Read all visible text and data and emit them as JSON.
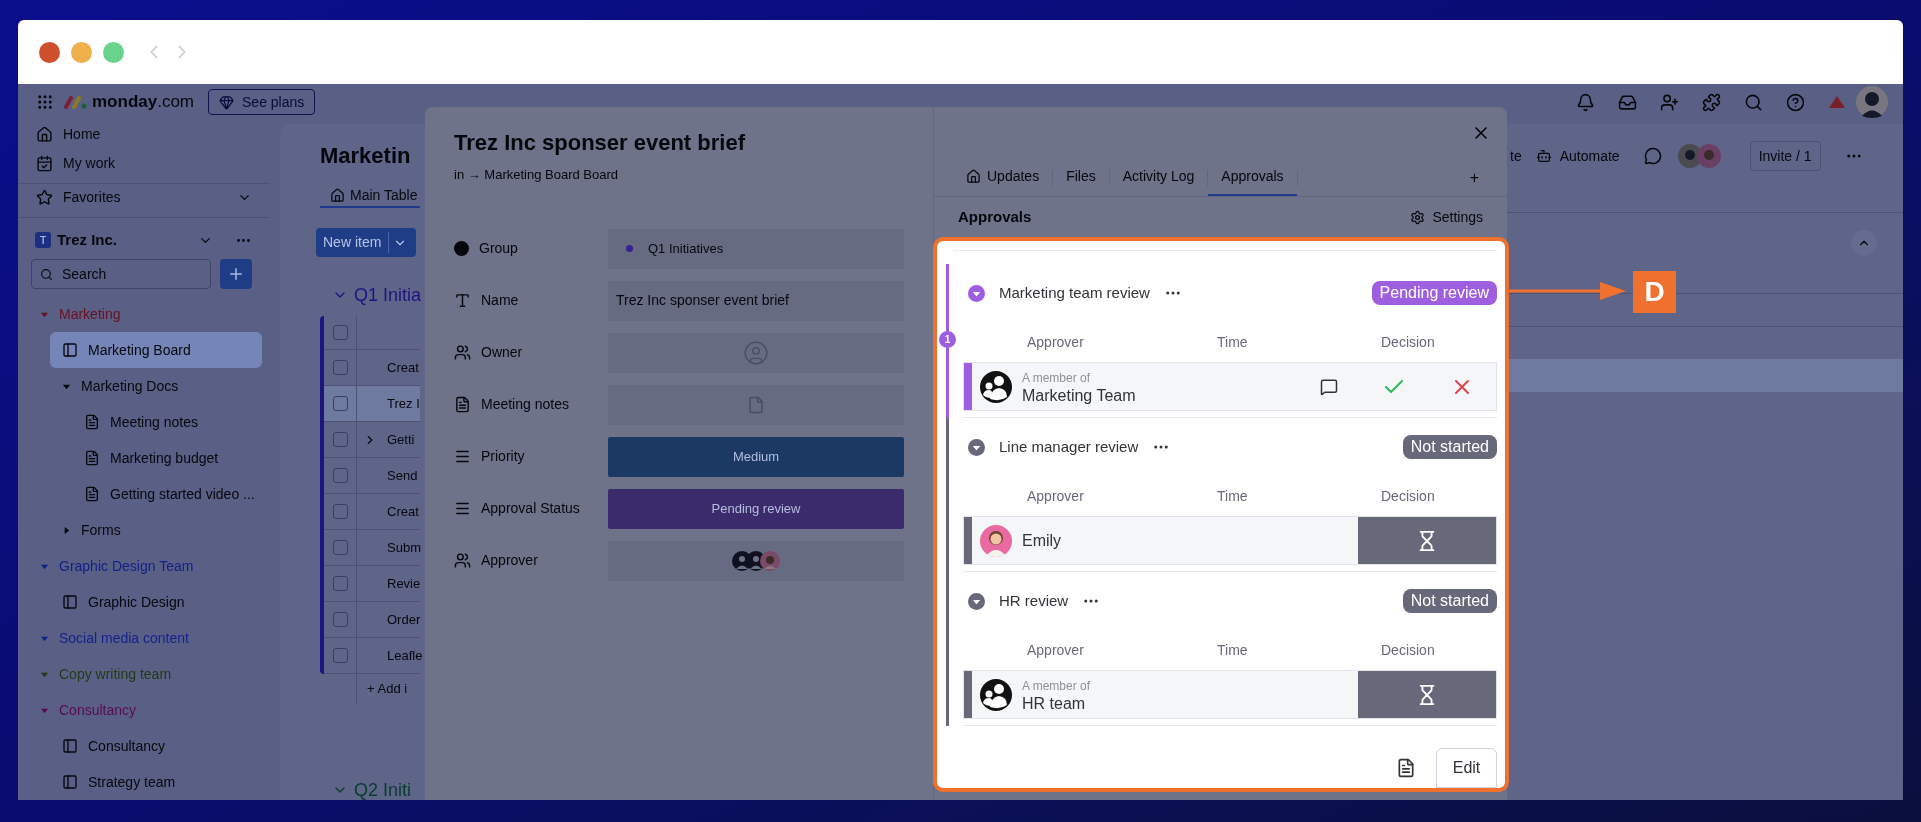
{
  "topbar": {
    "logo": {
      "name": "monday",
      "suffix": ".com"
    },
    "plans_button": "See plans"
  },
  "sidebar": {
    "nav": [
      {
        "label": "Home",
        "kind": "home"
      },
      {
        "label": "My work",
        "kind": "work"
      }
    ],
    "favorites": {
      "label": "Favorites",
      "expanded": false
    },
    "workspace": {
      "badge": "T",
      "name": "Trez Inc."
    },
    "search": {
      "placeholder": "Search"
    },
    "tree": [
      {
        "label": "Marketing",
        "kind": "folder",
        "color": "#6a0f20",
        "expanded": true,
        "selected": false,
        "children": [
          {
            "label": "Marketing Board",
            "kind": "board",
            "selected": true
          },
          {
            "label": "Marketing Docs",
            "kind": "folder",
            "color": "#06070d",
            "expanded": true,
            "selected": false,
            "children": [
              {
                "label": "Meeting notes",
                "kind": "doc",
                "selected": false
              },
              {
                "label": "Marketing budget",
                "kind": "doc",
                "selected": false
              },
              {
                "label": "Getting started video ...",
                "kind": "doc",
                "selected": false
              }
            ]
          },
          {
            "label": "Forms",
            "kind": "folder",
            "color": "#07080e",
            "expanded": false,
            "selected": false
          }
        ]
      },
      {
        "label": "Graphic Design Team",
        "kind": "folder",
        "color": "#14208a",
        "expanded": true,
        "selected": false,
        "children": [
          {
            "label": "Graphic Design",
            "kind": "board",
            "selected": false
          }
        ]
      },
      {
        "label": "Social media content",
        "kind": "folder",
        "color": "#15228c",
        "expanded": true,
        "selected": false
      },
      {
        "label": "Copy writing team",
        "kind": "folder",
        "color": "#1f3a14",
        "expanded": true,
        "selected": false
      },
      {
        "label": "Consultancy",
        "kind": "folder",
        "color": "#5a0a52",
        "expanded": true,
        "selected": false,
        "children": [
          {
            "label": "Consultancy",
            "kind": "board",
            "selected": false
          },
          {
            "label": "Strategy team",
            "kind": "board",
            "selected": false
          }
        ]
      }
    ]
  },
  "board": {
    "title": "Marketin",
    "tab": {
      "label": "Main Table",
      "selected": true
    },
    "new_item_button": "New item",
    "groups": [
      {
        "name": "Q1 Initia",
        "color": "#1e1480",
        "expanded": true,
        "select_all": {
          "checked": false
        },
        "rows": [
          {
            "name": "Creat",
            "selected": false,
            "checked": false,
            "expandable": false
          },
          {
            "name": "Trez I",
            "selected": true,
            "checked": false,
            "expandable": false
          },
          {
            "name": "Getti",
            "selected": false,
            "checked": false,
            "expandable": true
          },
          {
            "name": "Send",
            "selected": false,
            "checked": false,
            "expandable": false
          },
          {
            "name": "Creat",
            "selected": false,
            "checked": false,
            "expandable": false
          },
          {
            "name": "Subm",
            "selected": false,
            "checked": false,
            "expandable": false
          },
          {
            "name": "Revie",
            "selected": false,
            "checked": false,
            "expandable": false
          },
          {
            "name": "Order",
            "selected": false,
            "checked": false,
            "expandable": false
          },
          {
            "name": "Leafle",
            "selected": false,
            "checked": false,
            "expandable": false
          }
        ],
        "add_row": "+ Add i"
      },
      {
        "name": "Q2 Initi",
        "color": "#0a3a30",
        "expanded": true
      }
    ],
    "actions": {
      "integrate": "te",
      "automate": "Automate",
      "invite": "Invite / 1"
    }
  },
  "modal": {
    "title": "Trez Inc sponser event brief",
    "breadcrumb": "in → Marketing Board Board",
    "fields": [
      {
        "label": "Group",
        "kind": "group",
        "value": "Q1 Initiatives",
        "color": "#3a1f90"
      },
      {
        "label": "Name",
        "kind": "text",
        "value": "Trez Inc sponser event brief"
      },
      {
        "label": "Owner",
        "kind": "person"
      },
      {
        "label": "Meeting notes",
        "kind": "file"
      },
      {
        "label": "Priority",
        "kind": "status",
        "value": "Medium",
        "color": "#1b3962"
      },
      {
        "label": "Approval Status",
        "kind": "status",
        "value": "Pending review",
        "color": "#3c2b6c"
      },
      {
        "label": "Approver",
        "kind": "people"
      }
    ],
    "panel": {
      "tabs": [
        {
          "label": "Updates",
          "selected": false
        },
        {
          "label": "Files",
          "selected": false
        },
        {
          "label": "Activity Log",
          "selected": false
        },
        {
          "label": "Approvals",
          "selected": true
        }
      ],
      "add_tab": "+",
      "heading": "Approvals",
      "settings": "Settings",
      "stages": [
        {
          "kind": "active",
          "title": "Marketing team review",
          "status": "Pending review",
          "color": "#9d5fe0",
          "step": "1",
          "columns": [
            "Approver",
            "Time",
            "Decision"
          ],
          "approver": {
            "kind": "group",
            "caption": "A member of",
            "name": "Marketing Team"
          }
        },
        {
          "kind": "waiting",
          "title": "Line manager review",
          "status": "Not started",
          "color": "#676879",
          "columns": [
            "Approver",
            "Time",
            "Decision"
          ],
          "approver": {
            "kind": "person",
            "name": "Emily"
          }
        },
        {
          "kind": "waiting",
          "title": "HR review",
          "status": "Not started",
          "color": "#676879",
          "columns": [
            "Approver",
            "Time",
            "Decision"
          ],
          "approver": {
            "kind": "group",
            "caption": "A member of",
            "name": "HR team"
          }
        }
      ],
      "edit_button": "Edit"
    }
  },
  "annotation": {
    "label": "D"
  }
}
